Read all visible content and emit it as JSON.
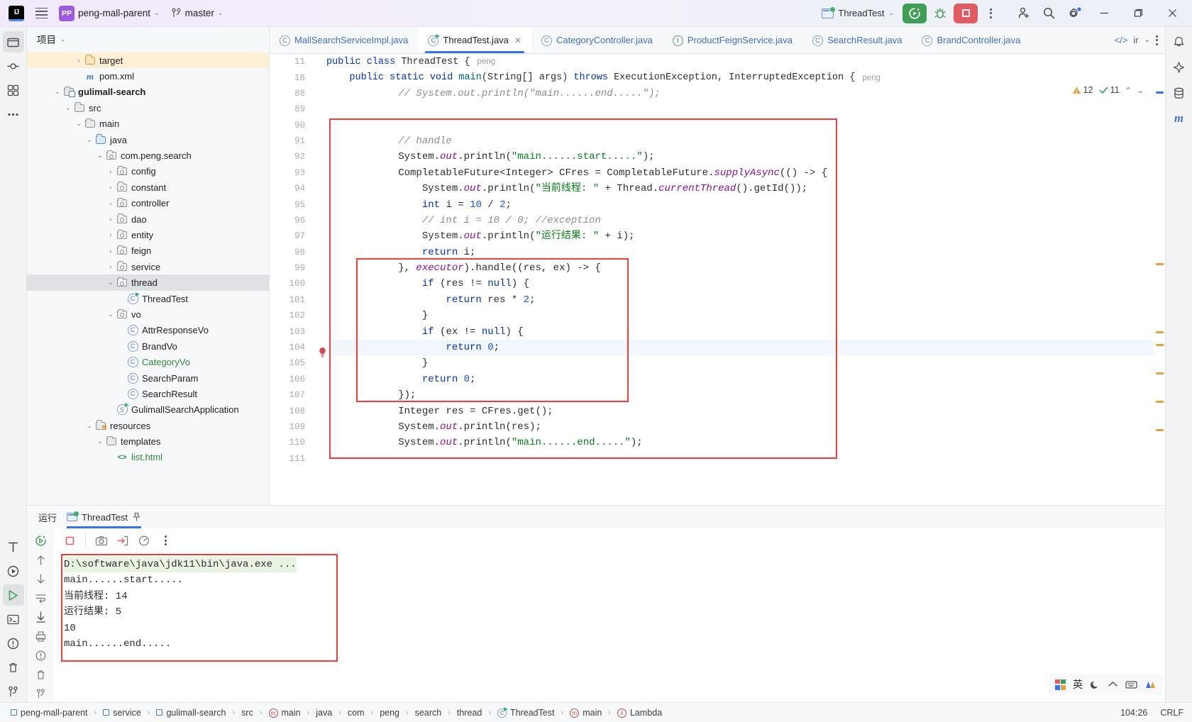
{
  "titlebar": {
    "logo": "IJ",
    "project_name": "peng-mall-parent",
    "branch": "master",
    "run_config": "ThreadTest",
    "icons": {
      "menu": "hamburger-icon",
      "project_badge": "PP",
      "branch": "git-branch-icon",
      "run": "run-icon",
      "debug": "debug-icon",
      "stop": "stop-icon",
      "more": "more-vertical-icon",
      "account": "add-account-icon",
      "search": "search-icon",
      "settings": "settings-icon",
      "minimize": "minimize-icon",
      "maximize": "maximize-icon",
      "close": "close-icon"
    }
  },
  "project_panel": {
    "title": "项目",
    "tree": [
      {
        "indent": 4,
        "arrow": "›",
        "icon": "folder-orange",
        "label": "target",
        "state": "sel-yellow"
      },
      {
        "indent": 4,
        "arrow": "",
        "icon": "maven",
        "label": "pom.xml",
        "state": ""
      },
      {
        "indent": 2,
        "arrow": "⌄",
        "icon": "module",
        "label": "gulimall-search",
        "state": "",
        "bold": true
      },
      {
        "indent": 3,
        "arrow": "⌄",
        "icon": "folder",
        "label": "src",
        "state": ""
      },
      {
        "indent": 4,
        "arrow": "⌄",
        "icon": "folder",
        "label": "main",
        "state": ""
      },
      {
        "indent": 5,
        "arrow": "⌄",
        "icon": "folder-blue",
        "label": "java",
        "state": ""
      },
      {
        "indent": 6,
        "arrow": "⌄",
        "icon": "package",
        "label": "com.peng.search",
        "state": ""
      },
      {
        "indent": 7,
        "arrow": "›",
        "icon": "package",
        "label": "config",
        "state": ""
      },
      {
        "indent": 7,
        "arrow": "›",
        "icon": "package",
        "label": "constant",
        "state": ""
      },
      {
        "indent": 7,
        "arrow": "›",
        "icon": "package",
        "label": "controller",
        "state": ""
      },
      {
        "indent": 7,
        "arrow": "›",
        "icon": "package",
        "label": "dao",
        "state": ""
      },
      {
        "indent": 7,
        "arrow": "›",
        "icon": "package",
        "label": "entity",
        "state": ""
      },
      {
        "indent": 7,
        "arrow": "›",
        "icon": "package",
        "label": "feign",
        "state": ""
      },
      {
        "indent": 7,
        "arrow": "›",
        "icon": "package",
        "label": "service",
        "state": ""
      },
      {
        "indent": 7,
        "arrow": "⌄",
        "icon": "package",
        "label": "thread",
        "state": "sel-grey"
      },
      {
        "indent": 8,
        "arrow": "",
        "icon": "class-run",
        "label": "ThreadTest",
        "state": ""
      },
      {
        "indent": 7,
        "arrow": "⌄",
        "icon": "package",
        "label": "vo",
        "state": ""
      },
      {
        "indent": 8,
        "arrow": "",
        "icon": "class",
        "label": "AttrResponseVo",
        "state": ""
      },
      {
        "indent": 8,
        "arrow": "",
        "icon": "class",
        "label": "BrandVo",
        "state": ""
      },
      {
        "indent": 8,
        "arrow": "",
        "icon": "class",
        "label": "CategoryVo",
        "state": "",
        "color": "green"
      },
      {
        "indent": 8,
        "arrow": "",
        "icon": "class",
        "label": "SearchParam",
        "state": ""
      },
      {
        "indent": 8,
        "arrow": "",
        "icon": "class",
        "label": "SearchResult",
        "state": ""
      },
      {
        "indent": 7,
        "arrow": "",
        "icon": "spring",
        "label": "GulimallSearchApplication",
        "state": ""
      },
      {
        "indent": 5,
        "arrow": "⌄",
        "icon": "folder-res",
        "label": "resources",
        "state": ""
      },
      {
        "indent": 6,
        "arrow": "⌄",
        "icon": "folder",
        "label": "templates",
        "state": ""
      },
      {
        "indent": 7,
        "arrow": "",
        "icon": "html",
        "label": "list.html",
        "state": "",
        "color": "green"
      }
    ]
  },
  "editor": {
    "tabs": [
      {
        "label": "MallSearchServiceImpl.java",
        "icon": "class-icon",
        "active": false,
        "closable": false
      },
      {
        "label": "ThreadTest.java",
        "icon": "class-run-icon",
        "active": true,
        "closable": true
      },
      {
        "label": "CategoryController.java",
        "icon": "class-icon",
        "active": false,
        "closable": false
      },
      {
        "label": "ProductFeignService.java",
        "icon": "interface-icon",
        "active": false,
        "closable": false
      },
      {
        "label": "SearchResult.java",
        "icon": "class-icon",
        "active": false,
        "closable": false
      },
      {
        "label": "BrandController.java",
        "icon": "class-icon",
        "active": false,
        "closable": false
      }
    ],
    "inspection": {
      "warnings": "12",
      "checks": "11"
    },
    "breadcrumb_lines": [
      {
        "num": "11",
        "text": "public class ThreadTest {",
        "author": "peng"
      },
      {
        "num": "16",
        "text": "    public static void main(String[] args) throws ExecutionException, InterruptedException {",
        "author": "peng"
      }
    ],
    "code_lines": [
      {
        "num": "88",
        "text": "        // System.out.println(\"main......end.....\");"
      },
      {
        "num": "89",
        "text": ""
      },
      {
        "num": "90",
        "text": ""
      },
      {
        "num": "91",
        "text": "        // handle"
      },
      {
        "num": "92",
        "text": "        System.out.println(\"main......start.....\");"
      },
      {
        "num": "93",
        "text": "        CompletableFuture<Integer> CFres = CompletableFuture.supplyAsync(() -> {"
      },
      {
        "num": "94",
        "text": "            System.out.println(\"当前线程: \" + Thread.currentThread().getId());"
      },
      {
        "num": "95",
        "text": "            int i = 10 / 2;"
      },
      {
        "num": "96",
        "text": "            // int i = 10 / 0; //exception"
      },
      {
        "num": "97",
        "text": "            System.out.println(\"运行结果: \" + i);"
      },
      {
        "num": "98",
        "text": "            return i;"
      },
      {
        "num": "99",
        "text": "        }, executor).handle((res, ex) -> {"
      },
      {
        "num": "100",
        "text": "            if (res != null) {"
      },
      {
        "num": "101",
        "text": "                return res * 2;"
      },
      {
        "num": "102",
        "text": "            }"
      },
      {
        "num": "103",
        "text": "            if (ex != null) {"
      },
      {
        "num": "104",
        "text": "                return 0;"
      },
      {
        "num": "105",
        "text": "            }"
      },
      {
        "num": "106",
        "text": "            return 0;"
      },
      {
        "num": "107",
        "text": "        });"
      },
      {
        "num": "108",
        "text": "        Integer res = CFres.get();"
      },
      {
        "num": "109",
        "text": "        System.out.println(res);"
      },
      {
        "num": "110",
        "text": "        System.out.println(\"main......end.....\");"
      },
      {
        "num": "111",
        "text": ""
      }
    ]
  },
  "run_panel": {
    "tab_label": "运行",
    "config_tab": "ThreadTest",
    "console": [
      {
        "text": "D:\\software\\java\\jdk11\\bin\\java.exe ...",
        "highlight": true
      },
      {
        "text": "main......start.....",
        "highlight": false
      },
      {
        "text": "当前线程: 14",
        "highlight": false
      },
      {
        "text": "运行结果: 5",
        "highlight": false
      },
      {
        "text": "10",
        "highlight": false
      },
      {
        "text": "main......end.....",
        "highlight": false
      }
    ]
  },
  "status_bar": {
    "crumbs": [
      "peng-mall-parent",
      "service",
      "gulimall-search",
      "src",
      "main",
      "java",
      "com",
      "peng",
      "search",
      "thread",
      "ThreadTest",
      "main",
      "Lambda"
    ],
    "caret": "104:26",
    "line_sep": "CRLF"
  },
  "tray": {
    "ime_label": "英"
  },
  "colors": {
    "accent": "#3574f0",
    "annotation": "#f03e3e",
    "run_green": "#3f9e55",
    "stop_red": "#e35b62",
    "string_green": "#067d17",
    "keyword_blue": "#0033b3"
  }
}
